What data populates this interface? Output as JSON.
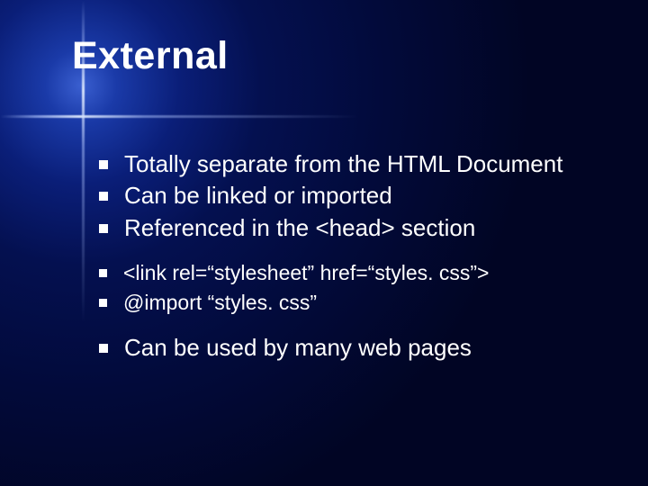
{
  "title": "External",
  "groups": [
    {
      "items": [
        {
          "text": "Totally separate from the HTML Document",
          "sub": false
        },
        {
          "text": "Can be linked or imported",
          "sub": false
        },
        {
          "text": "Referenced in the <head> section",
          "sub": false
        }
      ]
    },
    {
      "items": [
        {
          "text": "<link rel=“stylesheet” href=“styles. css”>",
          "sub": true
        },
        {
          "text": "@import “styles. css”",
          "sub": true
        }
      ]
    },
    {
      "items": [
        {
          "text": "Can be used by many web pages",
          "sub": false
        }
      ]
    }
  ]
}
